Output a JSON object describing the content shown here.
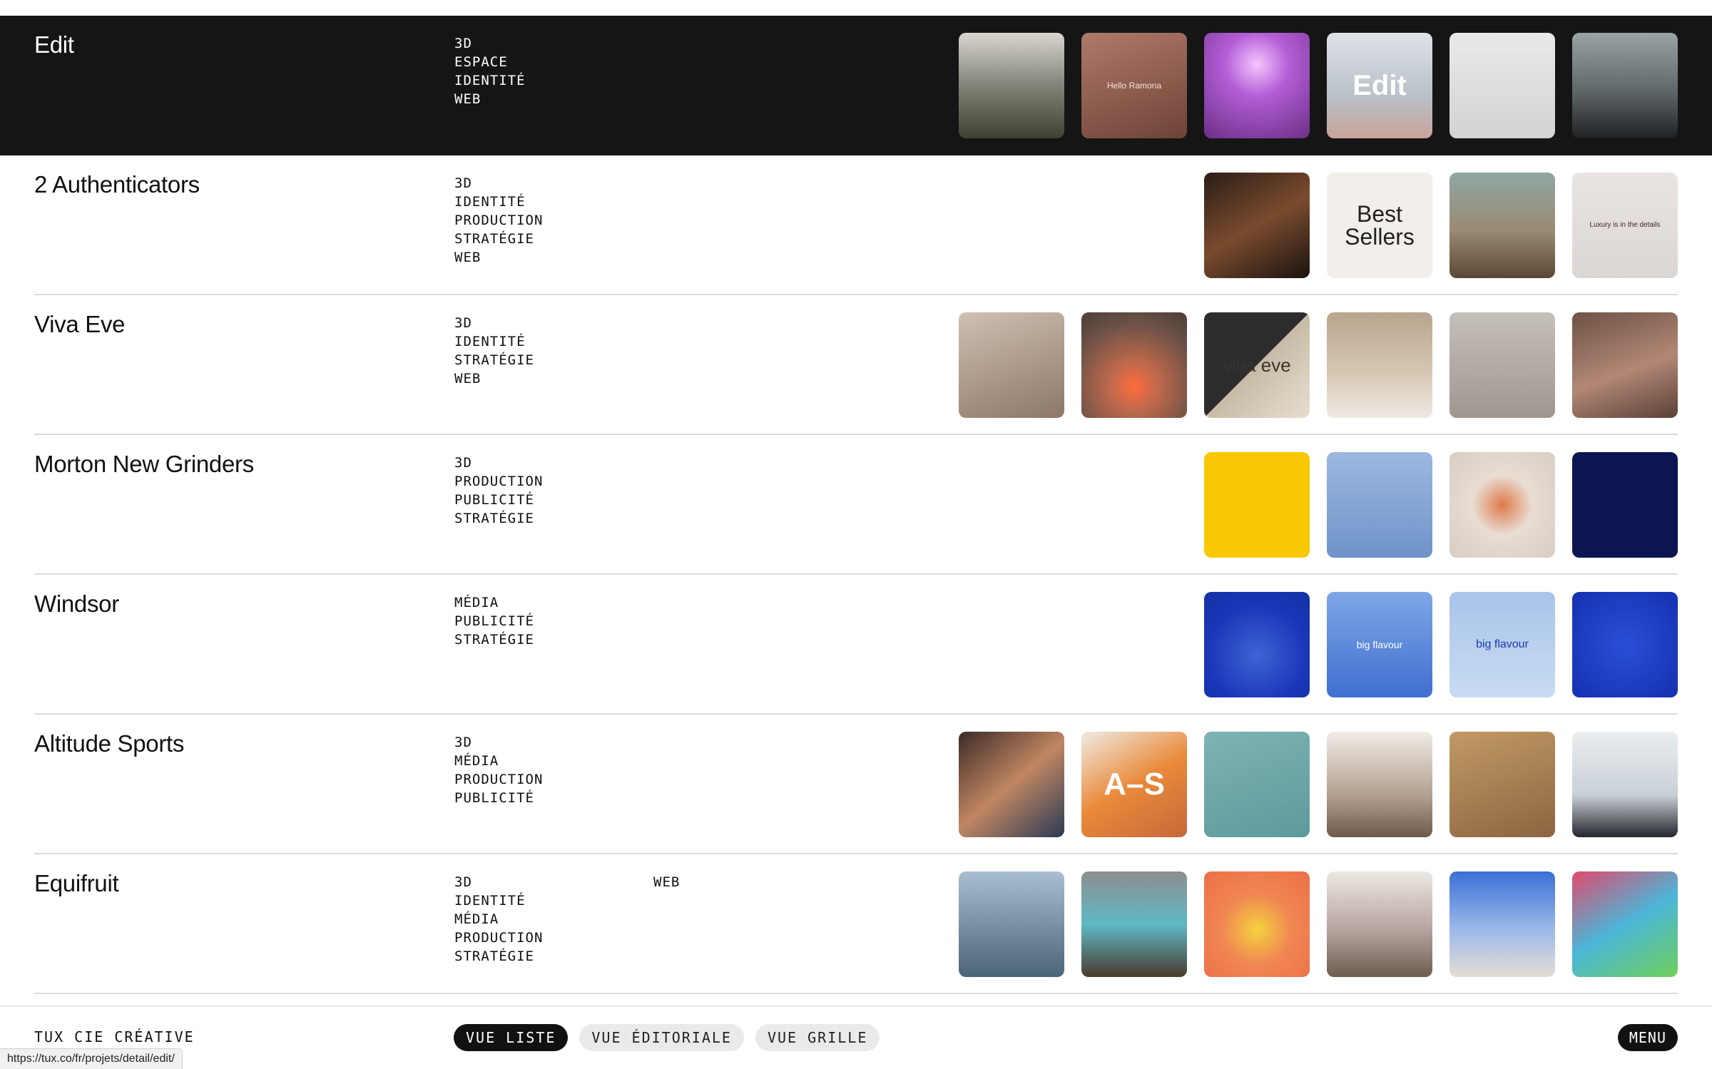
{
  "projects": [
    {
      "title": "Edit",
      "tags": [
        "3D",
        "ESPACE",
        "IDENTITÉ",
        "WEB"
      ],
      "tags_col2": [],
      "active": true,
      "thumbs": [
        {
          "name": "pavilion-render",
          "bg": "linear-gradient(180deg,#d9d6cf 0%,#8a8b80 45%,#3e4030 100%)",
          "text": ""
        },
        {
          "name": "phone-hello-ramona",
          "bg": "linear-gradient(160deg,#b07a6a 0%,#6e4337 100%)",
          "text": "Hello Ramona",
          "fg": "#f1e6d8",
          "size": "12px"
        },
        {
          "name": "purple-space",
          "bg": "radial-gradient(circle at 50% 30%,#f5c6ff 0%,#b45ed6 35%,#6b2f86 100%)",
          "text": ""
        },
        {
          "name": "edit-logo",
          "bg": "linear-gradient(180deg,#dfe3e8 0%,#b9c0c8 60%,#c9a49a 100%)",
          "text": "Edit",
          "fg": "#ffffff",
          "size": "40px",
          "weight": "700"
        },
        {
          "name": "white-device",
          "bg": "linear-gradient(180deg,#e9e9e9 0%,#d3d3d3 100%)",
          "text": ""
        },
        {
          "name": "cliff-structure",
          "bg": "linear-gradient(180deg,#9aa3a6 0%,#60676a 55%,#1f2224 100%)",
          "text": ""
        }
      ]
    },
    {
      "title": "2 Authenticators",
      "tags": [
        "3D",
        "IDENTITÉ",
        "PRODUCTION",
        "STRATÉGIE",
        "WEB"
      ],
      "tags_col2": [],
      "active": false,
      "thumbs": [
        {
          "name": "handbag-dark",
          "bg": "linear-gradient(150deg,#2a1d16 0%,#7a4b2e 50%,#1a1310 100%)",
          "text": ""
        },
        {
          "name": "best-sellers",
          "bg": "#f2eeea",
          "text": "Best Sellers",
          "fg": "#222",
          "size": "32px"
        },
        {
          "name": "bag-sculpture",
          "bg": "linear-gradient(180deg,#8fa7a3 0%,#9a8a72 55%,#5b4735 100%)",
          "text": ""
        },
        {
          "name": "phone-luxury",
          "bg": "linear-gradient(180deg,#e9e4e2 0%,#dcd6d3 100%)",
          "text": "Luxury is in the details",
          "fg": "#3a2a22",
          "size": "10px"
        }
      ]
    },
    {
      "title": "Viva Eve",
      "tags": [
        "3D",
        "IDENTITÉ",
        "STRATÉGIE",
        "WEB"
      ],
      "tags_col2": [],
      "active": false,
      "thumbs": [
        {
          "name": "portrait-woman",
          "bg": "linear-gradient(160deg,#cfc0b2 0%,#8e7766 100%)",
          "text": ""
        },
        {
          "name": "orange-dots",
          "bg": "radial-gradient(circle at 50% 70%,#ff6a3d 0%,#c26a4c 25%,#6b5147 70%,#4c3d38 100%)",
          "text": ""
        },
        {
          "name": "viva-eve-card",
          "bg": "linear-gradient(135deg,#2d2d2d 0%,#2d2d2d 50%,#c7bba6 50%,#e7dfcf 100%)",
          "text": "viva eve",
          "fg": "#3a332c",
          "size": "26px"
        },
        {
          "name": "living-room",
          "bg": "linear-gradient(180deg,#b9a48c 0%,#d8c9b6 60%,#efe9e2 100%)",
          "text": ""
        },
        {
          "name": "grey-chair",
          "bg": "linear-gradient(180deg,#c6c0ba 0%,#9f9690 100%)",
          "text": ""
        },
        {
          "name": "bare-back-portrait",
          "bg": "linear-gradient(160deg,#6d5244 0%,#b28776 55%,#5a4136 100%)",
          "text": ""
        }
      ]
    },
    {
      "title": "Morton New Grinders",
      "tags": [
        "3D",
        "PRODUCTION",
        "PUBLICITÉ",
        "STRATÉGIE"
      ],
      "tags_col2": [],
      "active": false,
      "thumbs": [
        {
          "name": "yellow-grinder-hand",
          "bg": "#f7c803",
          "text": ""
        },
        {
          "name": "grinders-row",
          "bg": "linear-gradient(180deg,#9cb8e0 0%,#6f93c9 100%)",
          "text": ""
        },
        {
          "name": "plate-food",
          "bg": "radial-gradient(circle at 50% 50%,#e07a4a 0%,#e8ddd3 40%,#d8cdc3 100%)",
          "text": ""
        },
        {
          "name": "salt-falling",
          "bg": "#0b1650",
          "text": ""
        }
      ]
    },
    {
      "title": "Windsor",
      "tags": [
        "MÉDIA",
        "PUBLICITÉ",
        "STRATÉGIE"
      ],
      "tags_col2": [],
      "active": false,
      "thumbs": [
        {
          "name": "drink-glass",
          "bg": "radial-gradient(circle at 50% 60%,#3f63d6 0%,#1b36b8 60%,#1330a4 100%)",
          "text": ""
        },
        {
          "name": "phone-sky",
          "bg": "linear-gradient(180deg,#7fa7e6 0%,#3f6fd0 100%)",
          "text": "big flavour",
          "fg": "#ffffff",
          "size": "14px"
        },
        {
          "name": "billboard-sky",
          "bg": "linear-gradient(180deg,#a9c4ea 0%,#c8dbf2 100%)",
          "text": "big flavour",
          "fg": "#1d3aa8",
          "size": "16px"
        },
        {
          "name": "corn-cob",
          "bg": "radial-gradient(circle at 50% 50%,#2a4fd6 0%,#1530b0 100%)",
          "text": ""
        }
      ]
    },
    {
      "title": "Altitude Sports",
      "tags": [
        "3D",
        "MÉDIA",
        "PRODUCTION",
        "PUBLICITÉ"
      ],
      "tags_col2": [],
      "active": false,
      "thumbs": [
        {
          "name": "face-closeup",
          "bg": "linear-gradient(140deg,#3d2b28 0%,#c08662 50%,#2a3b55 100%)",
          "text": ""
        },
        {
          "name": "runner-orange",
          "bg": "linear-gradient(150deg,#f0ebe4 0%,#e98a3a 50%,#c5693a 100%)",
          "text": "A–S",
          "fg": "#ffffff",
          "size": "44px",
          "weight": "700"
        },
        {
          "name": "hand-phone-teal",
          "bg": "linear-gradient(160deg,#7fb3b3 0%,#5d9a9c 100%)",
          "text": ""
        },
        {
          "name": "hiker-rocks",
          "bg": "linear-gradient(180deg,#f0ece6 0%,#b3a08f 60%,#6e5a4b 100%)",
          "text": ""
        },
        {
          "name": "flask-wood",
          "bg": "linear-gradient(160deg,#c29a66 0%,#8b6540 100%)",
          "text": ""
        },
        {
          "name": "cyclist-helmet",
          "bg": "linear-gradient(180deg,#e9edf0 0%,#c9d0d6 60%,#23262b 100%)",
          "text": ""
        }
      ]
    },
    {
      "title": "Equifruit",
      "tags": [
        "3D",
        "IDENTITÉ",
        "MÉDIA",
        "PRODUCTION",
        "STRATÉGIE"
      ],
      "tags_col2": [
        "WEB"
      ],
      "active": false,
      "thumbs": [
        {
          "name": "shark-banana",
          "bg": "linear-gradient(180deg,#a9bfd1 0%,#4a6478 100%)",
          "text": ""
        },
        {
          "name": "banana-pallets",
          "bg": "linear-gradient(180deg,#8c8e90 0%,#5fb9c5 50%,#4a3a2e 100%)",
          "text": ""
        },
        {
          "name": "bananas-orange",
          "bg": "radial-gradient(circle at 50% 55%,#f4d23d 0%,#f08653 45%,#ec6f48 100%)",
          "text": ""
        },
        {
          "name": "flowers-banana",
          "bg": "linear-gradient(180deg,#ece8e2 0%,#b8a4a0 55%,#6d5c4f 100%)",
          "text": ""
        },
        {
          "name": "rocket-banana",
          "bg": "linear-gradient(180deg,#3a6fd6 0%,#9cb9ea 55%,#e5ddd4 100%)",
          "text": ""
        },
        {
          "name": "phone-colorful",
          "bg": "linear-gradient(150deg,#e04a6d 0%,#4bb6d8 50%,#6fd05a 100%)",
          "text": ""
        }
      ]
    }
  ],
  "footer": {
    "brand": "TUX CIE CRÉATIVE",
    "views": [
      {
        "label": "VUE LISTE",
        "active": true
      },
      {
        "label": "VUE ÉDITORIALE",
        "active": false
      },
      {
        "label": "VUE GRILLE",
        "active": false
      }
    ],
    "menu_label": "MENU"
  },
  "status_url": "https://tux.co/fr/projets/detail/edit/"
}
